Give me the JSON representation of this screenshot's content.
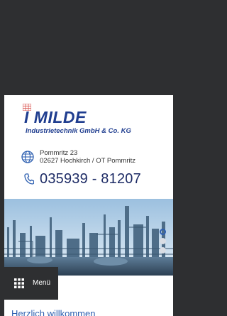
{
  "header": {
    "company_name": "I MILDE",
    "company_subtitle": "Industrietechnik GmbH & Co. KG",
    "logo_icon": "building-logo-icon"
  },
  "contact": {
    "address_line1": "Pommritz 23",
    "address_line2": "02627 Hochkirch / OT Pommritz",
    "phone": "035939 - 81207",
    "address_icon": "globe-icon",
    "phone_icon": "phone-icon"
  },
  "slider": {
    "slides_total": 3,
    "active_index": 0
  },
  "nav": {
    "menu_label": "Menü",
    "menu_icon": "grid-icon"
  },
  "main": {
    "heading": "Herzlich willkommen"
  },
  "colors": {
    "brand_blue": "#1f3d8f",
    "accent_blue": "#2d5fb0",
    "dark_bg": "#2e2f31"
  }
}
